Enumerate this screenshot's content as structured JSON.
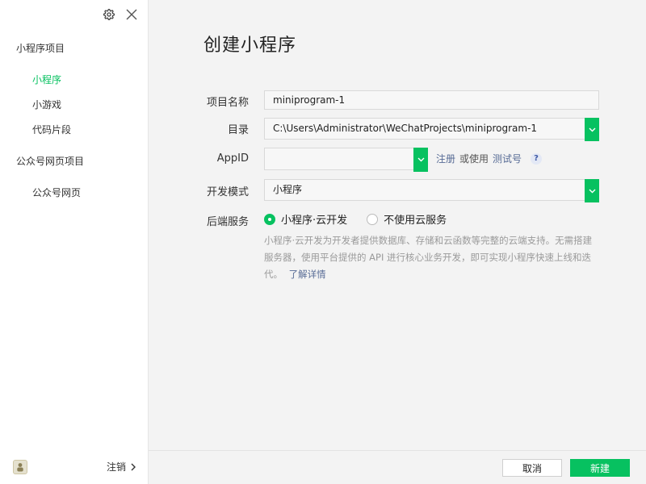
{
  "sidebar": {
    "sections": [
      {
        "title": "小程序项目",
        "items": [
          {
            "label": "小程序",
            "active": true
          },
          {
            "label": "小游戏",
            "active": false
          },
          {
            "label": "代码片段",
            "active": false
          }
        ]
      },
      {
        "title": "公众号网页项目",
        "items": [
          {
            "label": "公众号网页",
            "active": false
          }
        ]
      }
    ],
    "logout_label": "注销",
    "icons": {
      "settings": "gear-icon",
      "close": "close-icon",
      "avatar": "avatar-image",
      "logout_arrow": "chevron-right-icon"
    }
  },
  "main": {
    "title": "创建小程序",
    "form": {
      "project_name": {
        "label": "项目名称",
        "value": "miniprogram-1"
      },
      "directory": {
        "label": "目录",
        "value": "C:\\Users\\Administrator\\WeChatProjects\\miniprogram-1"
      },
      "appid": {
        "label": "AppID",
        "value": "",
        "register": "注册",
        "or_use": "或使用",
        "test_account": "测试号",
        "help": "?"
      },
      "dev_mode": {
        "label": "开发模式",
        "value": "小程序"
      },
      "backend": {
        "label": "后端服务",
        "options": [
          {
            "label": "小程序·云开发",
            "selected": true
          },
          {
            "label": "不使用云服务",
            "selected": false
          }
        ],
        "description": "小程序·云开发为开发者提供数据库、存储和云函数等完整的云端支持。无需搭建服务器，使用平台提供的 API 进行核心业务开发，即可实现小程序快速上线和迭代。",
        "learn_more": "了解详情"
      }
    }
  },
  "footer": {
    "cancel": "取消",
    "create": "新建"
  },
  "colors": {
    "accent": "#07c160",
    "link": "#576b95",
    "muted_text": "#9a9a9a"
  }
}
